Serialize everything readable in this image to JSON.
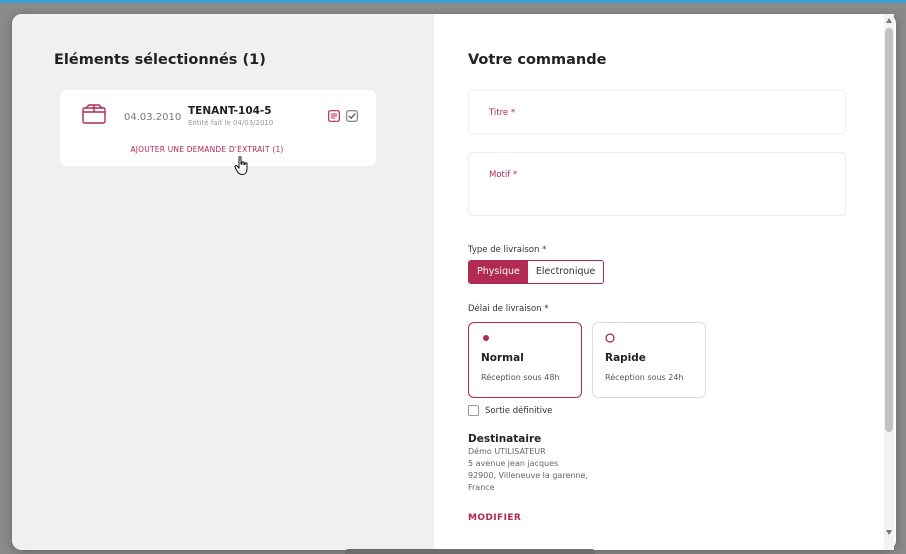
{
  "colors": {
    "accent": "#b02a52",
    "panel_gray": "#f0f0f0"
  },
  "left": {
    "title": "Eléments sélectionnés (1)",
    "item": {
      "icon": "box-icon",
      "date": "04.03.2010",
      "name": "TENANT-104-5",
      "subtitle": "Entité fait le 04/03/2010",
      "add_request_link": "AJOUTER UNE DEMANDE D'EXTRAIT (1)"
    }
  },
  "right": {
    "title": "Votre commande",
    "fields": {
      "title_label": "Titre *",
      "motif_label": "Motif *"
    },
    "delivery_type": {
      "label": "Type de livraison *",
      "options": [
        "Physique",
        "Electronique"
      ],
      "selected": "Physique"
    },
    "delivery_delay": {
      "label": "Délai de livraison *",
      "options": [
        {
          "title": "Normal",
          "subtitle": "Réception sous 48h",
          "selected": true
        },
        {
          "title": "Rapide",
          "subtitle": "Réception sous 24h",
          "selected": false
        }
      ]
    },
    "final_exit_label": "Sortie définitive",
    "recipient": {
      "title": "Destinataire",
      "lines": [
        "Démo UTILISATEUR",
        "5 avenue jean jacques",
        "92900, Villeneuve la garenne,",
        "France"
      ],
      "modify_label": "MODIFIER"
    }
  }
}
